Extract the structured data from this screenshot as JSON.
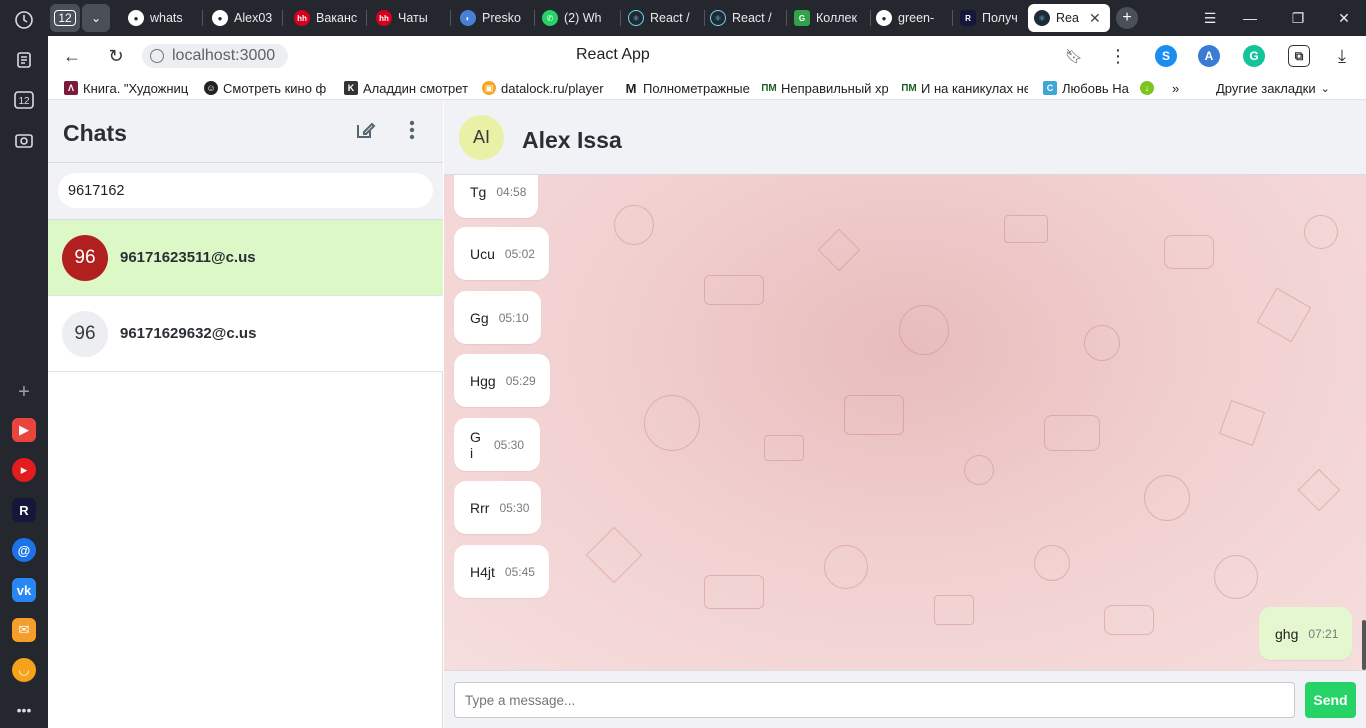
{
  "browser": {
    "tab_count": "12",
    "tabs": [
      {
        "label": "whats",
        "icon": "github-icon"
      },
      {
        "label": "Alex03",
        "icon": "github-icon"
      },
      {
        "label": "Ваканс",
        "icon": "hh-icon"
      },
      {
        "label": "Чаты",
        "icon": "hh-icon"
      },
      {
        "label": "Presko",
        "icon": "presko-icon"
      },
      {
        "label": "(2) Wh",
        "icon": "whatsapp-icon"
      },
      {
        "label": "React /",
        "icon": "react-icon"
      },
      {
        "label": "React /",
        "icon": "react-icon"
      },
      {
        "label": "Коллек",
        "icon": "green-g-icon"
      },
      {
        "label": "green-",
        "icon": "github-icon"
      },
      {
        "label": "Получ",
        "icon": "r-icon"
      },
      {
        "label": "Rea",
        "icon": "react-icon"
      }
    ],
    "url": "localhost:3000",
    "page_title": "React App",
    "bookmarks": [
      "Книга. \"Художниц",
      "Смотреть кино ф",
      "Аладдин смотреть",
      "datalock.ru/player",
      "Полнометражные",
      "Неправильный хр",
      "И на каникулах не",
      "Любовь На"
    ],
    "bookmarks_more": "»",
    "other_bookmarks": "Другие закладки"
  },
  "sidebar": {
    "title": "Chats",
    "search_value": "9617162",
    "chats": [
      {
        "avatar": "96",
        "name": "96171623511@c.us",
        "selected": true,
        "avatar_color": "#b21f1f"
      },
      {
        "avatar": "96",
        "name": "96171629632@c.us",
        "selected": false,
        "avatar_color": "#eceef1"
      }
    ]
  },
  "conversation": {
    "avatar": "AI",
    "name": "Alex Issa",
    "messages": [
      {
        "text": "Tg",
        "time": "04:58",
        "direction": "in"
      },
      {
        "text": "Ucu",
        "time": "05:02",
        "direction": "in"
      },
      {
        "text": "Gg",
        "time": "05:10",
        "direction": "in"
      },
      {
        "text": "Hgg",
        "time": "05:29",
        "direction": "in"
      },
      {
        "text": "G i",
        "time": "05:30",
        "direction": "in"
      },
      {
        "text": "Rrr",
        "time": "05:30",
        "direction": "in"
      },
      {
        "text": "H4jt",
        "time": "05:45",
        "direction": "in"
      },
      {
        "text": "ghg",
        "time": "07:21",
        "direction": "out"
      }
    ],
    "input_placeholder": "Type a message...",
    "send_label": "Send"
  },
  "colors": {
    "selected_chat_bg": "#dcf8c6",
    "send_button": "#25d366",
    "outgoing_bubble": "#e4f7cf",
    "chat_background": "#f1cfcf"
  }
}
